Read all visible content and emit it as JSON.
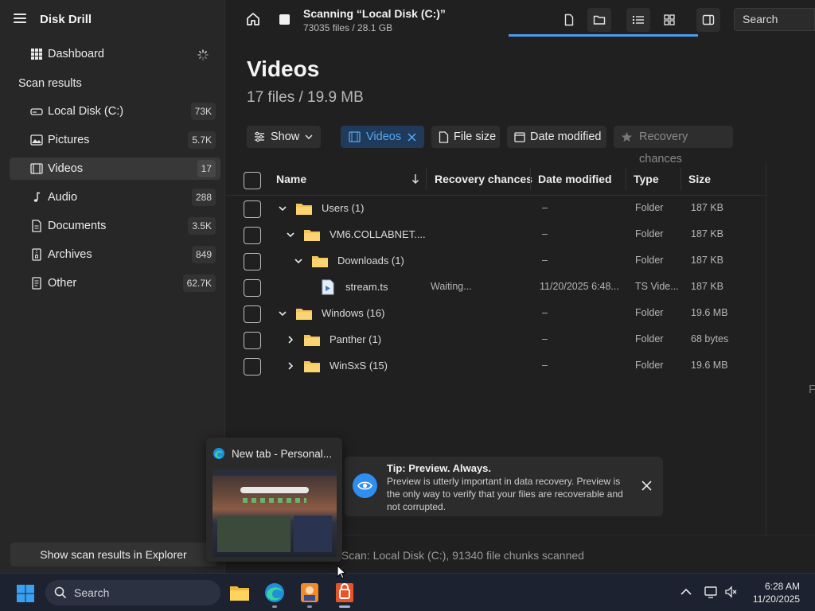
{
  "app": {
    "title": "Disk Drill",
    "scan_title": "Scanning “Local Disk (C:)”",
    "scan_subtitle": "73035 files / 28.1 GB"
  },
  "sidebar": {
    "dashboard_label": "Dashboard",
    "section_label": "Scan results",
    "items": [
      {
        "label": "Local Disk (C:)",
        "count": "73K",
        "icon": "drive-icon"
      },
      {
        "label": "Pictures",
        "count": "5.7K",
        "icon": "picture-icon"
      },
      {
        "label": "Videos",
        "count": "17",
        "icon": "video-icon"
      },
      {
        "label": "Audio",
        "count": "288",
        "icon": "music-note-icon"
      },
      {
        "label": "Documents",
        "count": "3.5K",
        "icon": "document-icon"
      },
      {
        "label": "Archives",
        "count": "849",
        "icon": "archive-icon"
      },
      {
        "label": "Other",
        "count": "62.7K",
        "icon": "other-file-icon"
      }
    ],
    "explorer_button": "Show scan results in Explorer"
  },
  "topbar": {
    "search_placeholder": "Search"
  },
  "main": {
    "title": "Videos",
    "subtitle": "17 files / 19.9 MB",
    "filters": {
      "show": "Show",
      "videos": "Videos",
      "file_size": "File size",
      "date_modified": "Date modified",
      "recovery_chances": "Recovery chances"
    }
  },
  "table": {
    "headers": {
      "name": "Name",
      "recovery": "Recovery chances",
      "date": "Date modified",
      "type": "Type",
      "size": "Size"
    },
    "rows": [
      {
        "name": "Users (1)",
        "recovery": "",
        "date": "–",
        "type": "Folder",
        "size": "187 KB"
      },
      {
        "name": "VM6.COLLABNET....",
        "recovery": "",
        "date": "–",
        "type": "Folder",
        "size": "187 KB"
      },
      {
        "name": "Downloads (1)",
        "recovery": "",
        "date": "–",
        "type": "Folder",
        "size": "187 KB"
      },
      {
        "name": "stream.ts",
        "recovery": "Waiting...",
        "date": "11/20/2025 6:48...",
        "type": "TS Vide...",
        "size": "187 KB"
      },
      {
        "name": "Windows (16)",
        "recovery": "",
        "date": "–",
        "type": "Folder",
        "size": "19.6 MB"
      },
      {
        "name": "Panther (1)",
        "recovery": "",
        "date": "–",
        "type": "Folder",
        "size": "68 bytes"
      },
      {
        "name": "WinSxS (15)",
        "recovery": "",
        "date": "–",
        "type": "Folder",
        "size": "19.6 MB"
      }
    ]
  },
  "edge_letter": "F",
  "status": {
    "text": "k Scan: Local Disk (C:), 91340 file chunks scanned"
  },
  "tip": {
    "title": "Tip: Preview. Always.",
    "body": "Preview is utterly important in data recovery. Preview is the only way to verify that your files are recoverable and not corrupted."
  },
  "preview": {
    "title": "New tab - Personal..."
  },
  "taskbar": {
    "search_label": "Search",
    "time": "6:28 AM",
    "date": "11/20/2025"
  },
  "colors": {
    "accent": "#4a9cf0",
    "folder": "#f5c45a",
    "sidebar_bg": "#272727",
    "main_bg": "#202020"
  }
}
